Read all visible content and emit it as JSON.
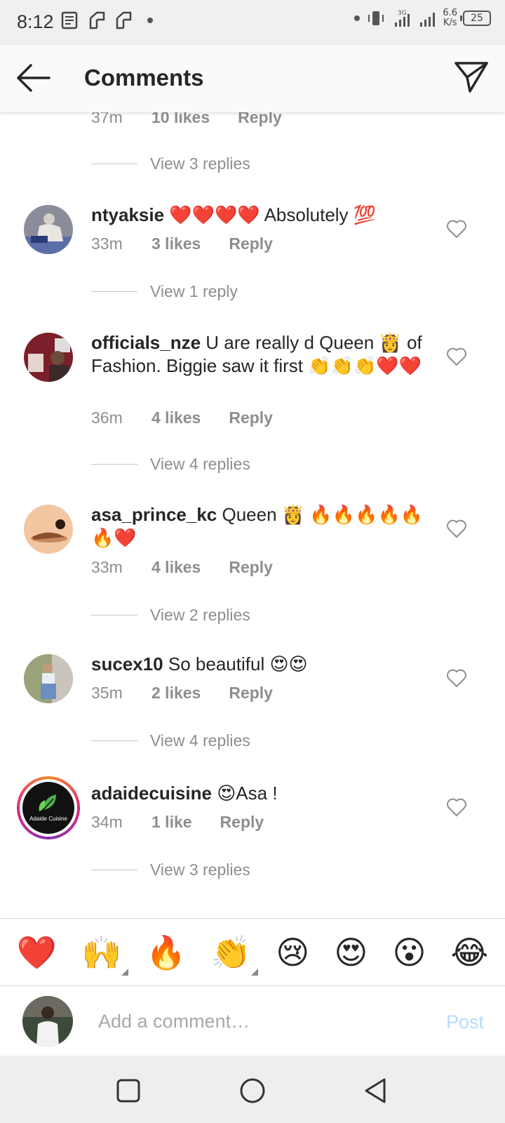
{
  "status_bar": {
    "time": "8:12",
    "net_speed_value": "6.6",
    "net_speed_unit": "K/s",
    "network_label": "3G",
    "battery": "25"
  },
  "header": {
    "title": "Comments"
  },
  "comments_list": {
    "top_partial": {
      "time": "37m",
      "likes": "10 likes",
      "reply": "Reply",
      "view_replies": "View 3 replies"
    },
    "comments": [
      {
        "username": "ntyaksie",
        "text": "❤️❤️❤️❤️ Absolutely 💯",
        "time": "33m",
        "likes": "3 likes",
        "reply": "Reply",
        "view_replies": "View 1 reply"
      },
      {
        "username": "officials_nze",
        "text": "U are really d Queen 👸 of Fashion. Biggie saw it first 👏👏👏❤️❤️",
        "time": "36m",
        "likes": "4 likes",
        "reply": "Reply",
        "view_replies": "View 4 replies"
      },
      {
        "username": "asa_prince_kc",
        "text": "Queen 👸 🔥🔥🔥🔥🔥🔥❤️",
        "time": "33m",
        "likes": "4 likes",
        "reply": "Reply",
        "view_replies": "View 2 replies"
      },
      {
        "username": "sucex10",
        "text": "So beautiful 😍😍",
        "time": "35m",
        "likes": "2 likes",
        "reply": "Reply",
        "view_replies": "View 4 replies"
      },
      {
        "username": "adaidecuisine",
        "text": "😍Asa !",
        "time": "34m",
        "likes": "1 like",
        "reply": "Reply",
        "view_replies": "View 3 replies",
        "avatar_logo_text": "Adaide Cuisine"
      }
    ]
  },
  "emoji_bar": [
    "❤️",
    "🙌",
    "🔥",
    "👏",
    "😢",
    "😍",
    "😮",
    "😂"
  ],
  "comment_input": {
    "placeholder": "Add a comment…",
    "post_label": "Post"
  },
  "colors": {
    "text_primary": "#262626",
    "text_secondary": "#8e8e8e",
    "post_disabled": "#b3dbff",
    "story_ring_start": "#f58529",
    "story_ring_mid": "#dd2a7b"
  }
}
